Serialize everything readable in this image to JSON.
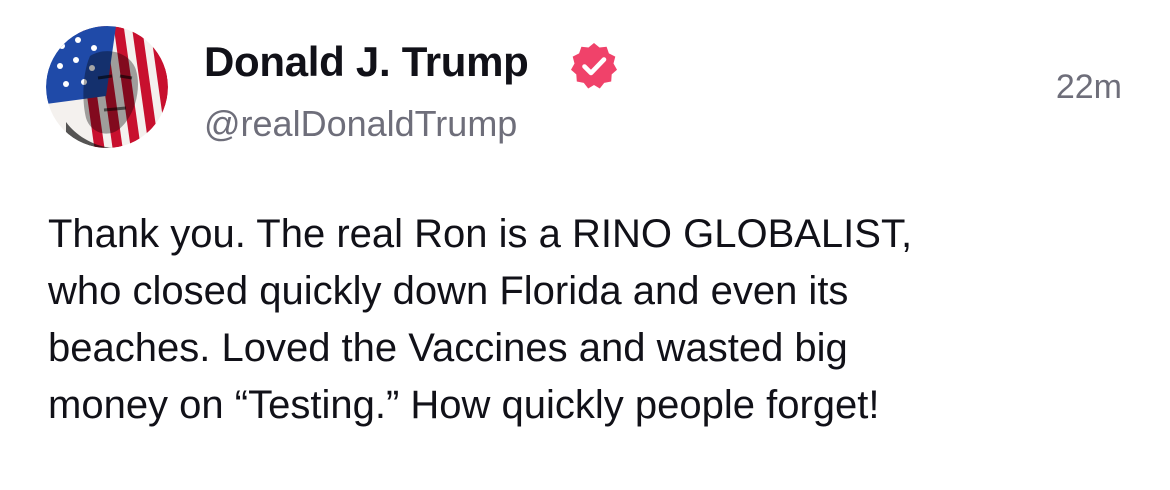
{
  "post": {
    "author": {
      "display_name": "Donald J. Trump",
      "handle": "@realDonaldTrump",
      "verified": true,
      "verified_icon": "verified-badge-icon",
      "badge_color": "#f0426a"
    },
    "timestamp": "22m",
    "body_lines": [
      "Thank you. The real Ron is a RINO GLOBALIST,",
      "who closed quickly down Florida and even its",
      "beaches. Loved the Vaccines and wasted big",
      "money on “Testing.” How quickly people forget!"
    ]
  },
  "colors": {
    "text": "#111118",
    "muted": "#6e6e7a",
    "background": "#ffffff",
    "flag_red": "#c8102e",
    "flag_blue": "#1f4aa8"
  }
}
